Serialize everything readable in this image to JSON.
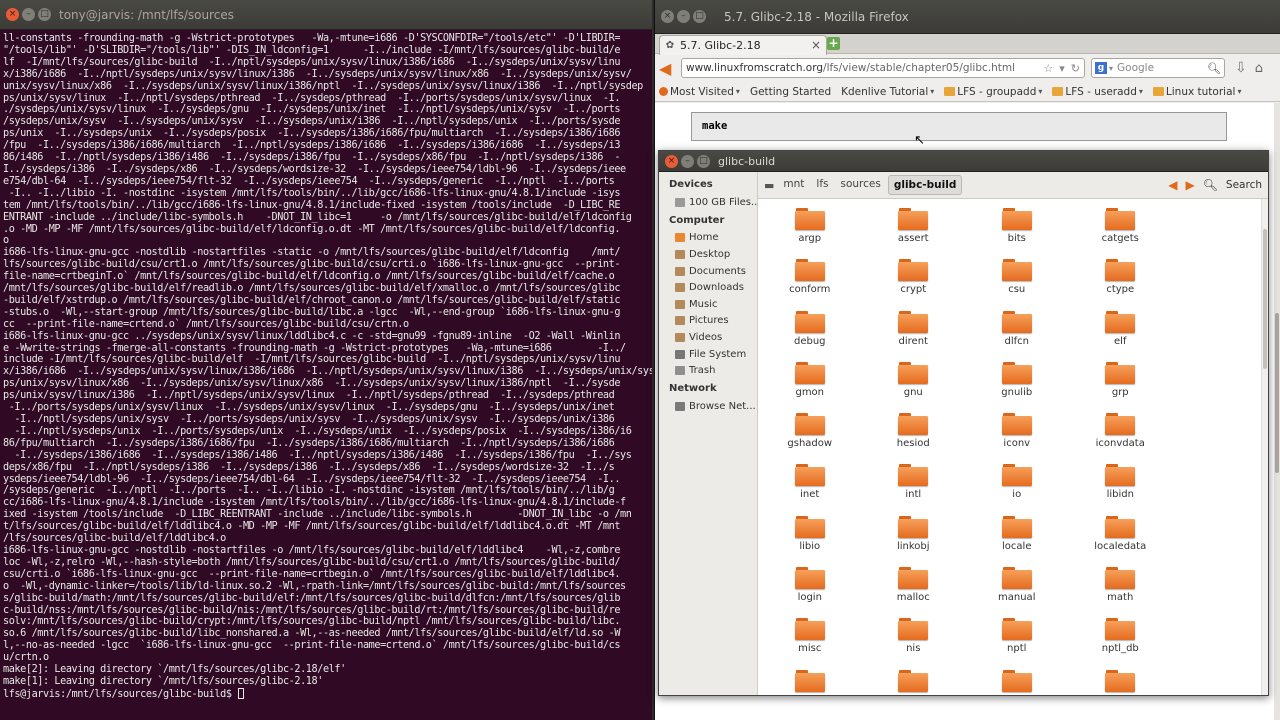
{
  "terminal": {
    "title": "tony@jarvis: /mnt/lfs/sources",
    "lines": [
      "ll-constants -frounding-math -g -Wstrict-prototypes   -Wa,-mtune=i686 -D'SYSCONFDIR=\"/tools/etc\"' -D'LIBDIR=",
      "\"/tools/lib\"' -D'SLIBDIR=\"/tools/lib\"' -DIS_IN_ldconfig=1      -I../include -I/mnt/lfs/sources/glibc-build/e",
      "lf  -I/mnt/lfs/sources/glibc-build  -I../nptl/sysdeps/unix/sysv/linux/i386/i686  -I../sysdeps/unix/sysv/linu",
      "x/i386/i686  -I../nptl/sysdeps/unix/sysv/linux/i386  -I../sysdeps/unix/sysv/linux/x86  -I../sysdeps/unix/sysv/",
      "unix/sysv/linux/x86  -I../sysdeps/unix/sysv/linux/i386/nptl  -I../sysdeps/unix/sysv/linux/i386  -I../nptl/sysdep",
      "ps/unix/sysv/linux  -I../nptl/sysdeps/pthread  -I../sysdeps/pthread  -I../ports/sysdeps/unix/sysv/linux  -I.",
      "./sysdeps/unix/sysv/linux  -I../sysdeps/gnu  -I../sysdeps/unix/inet  -I../nptl/sysdeps/unix/sysv  -I../ports",
      "/sysdeps/unix/sysv  -I../sysdeps/unix/sysv  -I../sysdeps/unix/i386  -I../nptl/sysdeps/unix  -I../ports/sysde",
      "ps/unix  -I../sysdeps/unix  -I../sysdeps/posix  -I../sysdeps/i386/i686/fpu/multiarch  -I../sysdeps/i386/i686",
      "/fpu  -I../sysdeps/i386/i686/multiarch  -I../nptl/sysdeps/i386/i686  -I../sysdeps/i386/i686  -I../sysdeps/i3",
      "86/i486  -I../nptl/sysdeps/i386/i486  -I../sysdeps/i386/fpu  -I../sysdeps/x86/fpu  -I../nptl/sysdeps/i386  -",
      "I../sysdeps/i386  -I../sysdeps/x86  -I../sysdeps/wordsize-32  -I../sysdeps/ieee754/ldbl-96  -I../sysdeps/ieee",
      "e754/dbl-64  -I../sysdeps/ieee754/flt-32  -I../sysdeps/ieee754  -I../sysdeps/generic  -I../nptl  -I../ports",
      " -I.. -I../libio -I. -nostdinc -isystem /mnt/lfs/tools/bin/../lib/gcc/i686-lfs-linux-gnu/4.8.1/include -isys",
      "tem /mnt/lfs/tools/bin/../lib/gcc/i686-lfs-linux-gnu/4.8.1/include-fixed -isystem /tools/include  -D_LIBC_RE",
      "ENTRANT -include ../include/libc-symbols.h    -DNOT_IN_libc=1     -o /mnt/lfs/sources/glibc-build/elf/ldconfig",
      ".o -MD -MP -MF /mnt/lfs/sources/glibc-build/elf/ldconfig.o.dt -MT /mnt/lfs/sources/glibc-build/elf/ldconfig.",
      "o",
      "i686-lfs-linux-gnu-gcc -nostdlib -nostartfiles -static -o /mnt/lfs/sources/glibc-build/elf/ldconfig    /mnt/",
      "lfs/sources/glibc-build/csu/crt1.o /mnt/lfs/sources/glibc-build/csu/crti.o `i686-lfs-linux-gnu-gcc  --print-",
      "file-name=crtbeginT.o` /mnt/lfs/sources/glibc-build/elf/ldconfig.o /mnt/lfs/sources/glibc-build/elf/cache.o",
      "/mnt/lfs/sources/glibc-build/elf/readlib.o /mnt/lfs/sources/glibc-build/elf/xmalloc.o /mnt/lfs/sources/glibc",
      "-build/elf/xstrdup.o /mnt/lfs/sources/glibc-build/elf/chroot_canon.o /mnt/lfs/sources/glibc-build/elf/static",
      "-stubs.o  -Wl,--start-group /mnt/lfs/sources/glibc-build/libc.a -lgcc  -Wl,--end-group `i686-lfs-linux-gnu-g",
      "cc  --print-file-name=crtend.o` /mnt/lfs/sources/glibc-build/csu/crtn.o",
      "i686-lfs-linux-gnu-gcc ../sysdeps/unix/sysv/linux/lddlibc4.c -c -std=gnu99 -fgnu89-inline  -O2 -Wall -Winlin",
      "e -Wwrite-strings -fmerge-all-constants -frounding-math -g -Wstrict-prototypes   -Wa,-mtune=i686        -I../",
      "include -I/mnt/lfs/sources/glibc-build/elf  -I/mnt/lfs/sources/glibc-build  -I../nptl/sysdeps/unix/sysv/linu",
      "x/i386/i686  -I../sysdeps/unix/sysv/linux/i386/i686  -I../nptl/sysdeps/unix/sysv/linux/i386  -I../sysdeps/unix/sysv/linux/i386",
      "ps/unix/sysv/linux/x86  -I../sysdeps/unix/sysv/linux/x86  -I../sysdeps/unix/sysv/linux/i386/nptl  -I../sysde",
      "ps/unix/sysv/linux/i386  -I../nptl/sysdeps/unix/sysv/linux  -I../nptl/sysdeps/pthread  -I../sysdeps/pthread",
      " -I../ports/sysdeps/unix/sysv/linux  -I../sysdeps/unix/sysv/linux  -I../sysdeps/gnu  -I../sysdeps/unix/inet",
      "  -I../nptl/sysdeps/unix/sysv  -I../ports/sysdeps/unix/sysv  -I../sysdeps/unix/sysv  -I../sysdeps/unix/i386",
      "  -I../nptl/sysdeps/unix  -I../ports/sysdeps/unix  -I../sysdeps/unix  -I../sysdeps/posix  -I../sysdeps/i386/i6",
      "86/fpu/multiarch  -I../sysdeps/i386/i686/fpu  -I../sysdeps/i386/i686/multiarch  -I../nptl/sysdeps/i386/i686",
      "  -I../sysdeps/i386/i686  -I../sysdeps/i386/i486  -I../nptl/sysdeps/i386/i486  -I../sysdeps/i386/fpu  -I../sys",
      "deps/x86/fpu  -I../nptl/sysdeps/i386  -I../sysdeps/i386  -I../sysdeps/x86  -I../sysdeps/wordsize-32  -I../s",
      "ysdeps/ieee754/ldbl-96  -I../sysdeps/ieee754/dbl-64  -I../sysdeps/ieee754/flt-32  -I../sysdeps/ieee754  -I..",
      "/sysdeps/generic  -I../nptl  -I../ports  -I.. -I../libio -I. -nostdinc -isystem /mnt/lfs/tools/bin/../lib/g",
      "cc/i686-lfs-linux-gnu/4.8.1/include -isystem /mnt/lfs/tools/bin/../lib/gcc/i686-lfs-linux-gnu/4.8.1/include-f",
      "ixed -isystem /tools/include  -D_LIBC_REENTRANT -include ../include/libc-symbols.h        -DNOT_IN_libc -o /mn",
      "t/lfs/sources/glibc-build/elf/lddlibc4.o -MD -MP -MF /mnt/lfs/sources/glibc-build/elf/lddlibc4.o.dt -MT /mnt",
      "/lfs/sources/glibc-build/elf/lddlibc4.o",
      "i686-lfs-linux-gnu-gcc -nostdlib -nostartfiles -o /mnt/lfs/sources/glibc-build/elf/lddlibc4    -Wl,-z,combre",
      "loc -Wl,-z,relro -Wl,--hash-style=both /mnt/lfs/sources/glibc-build/csu/crt1.o /mnt/lfs/sources/glibc-build/",
      "csu/crti.o `i686-lfs-linux-gnu-gcc  --print-file-name=crtbegin.o` /mnt/lfs/sources/glibc-build/elf/lddlibc4.",
      "o  -Wl,-dynamic-linker=/tools/lib/ld-linux.so.2 -Wl,-rpath-link=/mnt/lfs/sources/glibc-build:/mnt/lfs/sources",
      "s/glibc-build/math:/mnt/lfs/sources/glibc-build/elf:/mnt/lfs/sources/glibc-build/dlfcn:/mnt/lfs/sources/glib",
      "c-build/nss:/mnt/lfs/sources/glibc-build/nis:/mnt/lfs/sources/glibc-build/rt:/mnt/lfs/sources/glibc-build/re",
      "solv:/mnt/lfs/sources/glibc-build/crypt:/mnt/lfs/sources/glibc-build/nptl /mnt/lfs/sources/glibc-build/libc.",
      "so.6 /mnt/lfs/sources/glibc-build/libc_nonshared.a -Wl,--as-needed /mnt/lfs/sources/glibc-build/elf/ld.so -W",
      "l,--no-as-needed -lgcc  `i686-lfs-linux-gnu-gcc  --print-file-name=crtend.o` /mnt/lfs/sources/glibc-build/cs",
      "u/crtn.o",
      "make[2]: Leaving directory `/mnt/lfs/sources/glibc-2.18/elf'",
      "make[1]: Leaving directory `/mnt/lfs/sources/glibc-2.18'"
    ],
    "prompt": "lfs@jarvis:/mnt/lfs/sources/glibc-build$ "
  },
  "firefox": {
    "title": "5.7. Glibc-2.18 - Mozilla Firefox",
    "tab_label": "5.7. Glibc-2.18",
    "url_domain": "www.linuxfromscratch.org",
    "url_path": "/lfs/view/stable/chapter05/glibc.html",
    "search_placeholder": "Google",
    "bookmarks": [
      {
        "label": "Most Visited",
        "icon": "orange",
        "menu": true
      },
      {
        "label": "Getting Started",
        "icon": "page",
        "menu": false
      },
      {
        "label": "Kdenlive Tutorial",
        "icon": "page",
        "menu": true
      },
      {
        "label": "LFS - groupadd",
        "icon": "folder",
        "menu": true
      },
      {
        "label": "LFS - useradd",
        "icon": "folder",
        "menu": true
      },
      {
        "label": "Linux tutorial",
        "icon": "folder",
        "menu": true
      }
    ],
    "code": "make"
  },
  "nautilus": {
    "title": "glibc-build",
    "sidebar": {
      "devices_heading": "Devices",
      "devices": [
        {
          "label": "100 GB Files...",
          "icon": "disk"
        }
      ],
      "computer_heading": "Computer",
      "computer": [
        {
          "label": "Home",
          "icon": "home"
        },
        {
          "label": "Desktop",
          "icon": "folder"
        },
        {
          "label": "Documents",
          "icon": "folder"
        },
        {
          "label": "Downloads",
          "icon": "folder"
        },
        {
          "label": "Music",
          "icon": "folder"
        },
        {
          "label": "Pictures",
          "icon": "folder"
        },
        {
          "label": "Videos",
          "icon": "folder"
        },
        {
          "label": "File System",
          "icon": "fs"
        },
        {
          "label": "Trash",
          "icon": "trash"
        }
      ],
      "network_heading": "Network",
      "network": [
        {
          "label": "Browse Net...",
          "icon": "net"
        }
      ]
    },
    "breadcrumbs": [
      "mnt",
      "lfs",
      "sources",
      "glibc-build"
    ],
    "search_label": "Search",
    "folders": [
      "argp",
      "assert",
      "bits",
      "catgets",
      "conform",
      "crypt",
      "csu",
      "ctype",
      "debug",
      "dirent",
      "dlfcn",
      "elf",
      "gmon",
      "gnu",
      "gnulib",
      "grp",
      "gshadow",
      "hesiod",
      "iconv",
      "iconvdata",
      "inet",
      "intl",
      "io",
      "libidn",
      "libio",
      "linkobj",
      "locale",
      "localedata",
      "login",
      "malloc",
      "manual",
      "math",
      "misc",
      "nis",
      "nptl",
      "nptl_db",
      "",
      "",
      "",
      ""
    ]
  }
}
